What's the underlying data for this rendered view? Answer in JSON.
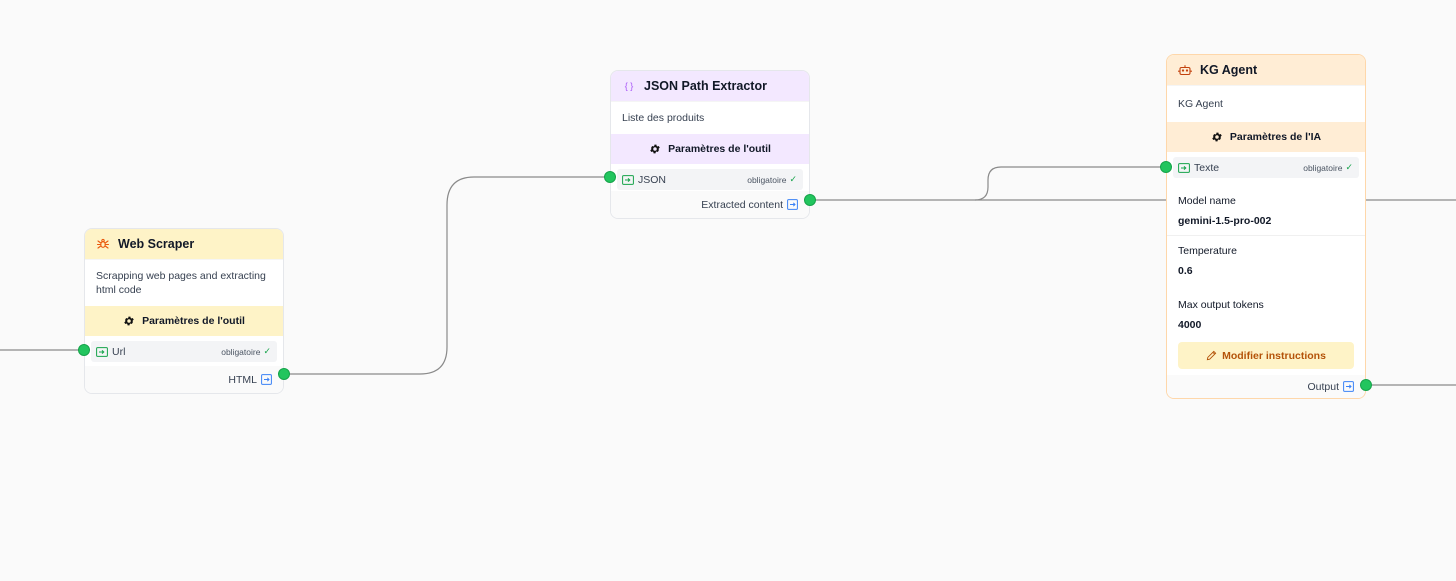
{
  "colors": {
    "handle": "#22c55e",
    "edge": "#8a8a8a",
    "yellow_header": "#fef3c7",
    "purple_header": "#f3e8ff",
    "orange_header": "#ffedd5",
    "accent_orange": "#b45309"
  },
  "web_scraper": {
    "icon": "spider-icon",
    "title": "Web Scraper",
    "description": "Scrapping web pages and extracting html code",
    "params_label": "Paramètres de l'outil",
    "input": {
      "label": "Url",
      "required": "obligatoire",
      "check": "✓"
    },
    "output": {
      "label": "HTML"
    }
  },
  "json_extractor": {
    "icon": "braces-icon",
    "icon_glyph": "{ }",
    "title": "JSON Path Extractor",
    "description": "Liste des produits",
    "params_label": "Paramètres de l'outil",
    "input": {
      "label": "JSON",
      "required": "obligatoire",
      "check": "✓"
    },
    "output": {
      "label": "Extracted content"
    }
  },
  "kg_agent": {
    "icon": "robot-icon",
    "title": "KG Agent",
    "description": "KG Agent",
    "params_label": "Paramètres de l'IA",
    "input": {
      "label": "Texte",
      "required": "obligatoire",
      "check": "✓"
    },
    "fields": [
      {
        "label": "Model name",
        "value": "gemini-1.5-pro-002"
      },
      {
        "label": "Temperature",
        "value": "0.6"
      },
      {
        "label": "Max output tokens",
        "value": "4000"
      }
    ],
    "modify_button": "Modifier instructions",
    "output": {
      "label": "Output"
    }
  }
}
